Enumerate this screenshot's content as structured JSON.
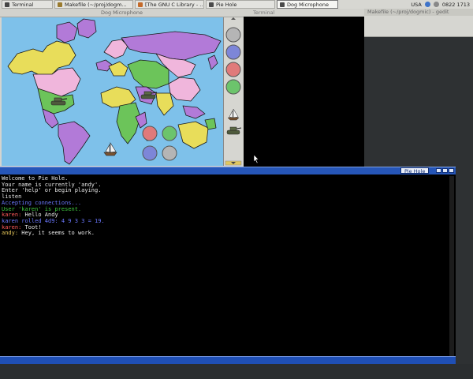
{
  "taskbar": {
    "tasks": [
      {
        "label": "Terminal",
        "color": "#454545"
      },
      {
        "label": "Makefile (~/proj/dogm...",
        "color": "#9a7b2f"
      },
      {
        "label": "[The GNU C Library - ...",
        "color": "#c46a2a"
      },
      {
        "label": "Pie Hole",
        "color": "#4a4a4a"
      },
      {
        "label": "Dog Microphone",
        "color": "#4a4a4a"
      }
    ],
    "tray": {
      "locale": "USA",
      "clock": "0822 1713"
    }
  },
  "windows": {
    "dog_microphone_title": "Dog Microphone",
    "terminal_title": "Terminal",
    "gedit_title": "Makefile (~/proj/dogmic) - gedit",
    "pie_hole_title": "Pie Hole"
  },
  "palette": {
    "swatches": [
      "#b5b5b5",
      "#7d86d8",
      "#e07a7a",
      "#6cc46c"
    ],
    "tools": [
      "boat-icon",
      "tank-icon"
    ]
  },
  "map": {
    "colors": {
      "ocean": "#7ec1ea",
      "purple": "#b27ad8",
      "yellow": "#e8dd5a",
      "pink": "#f0b6dc",
      "green": "#6cc45a"
    },
    "tokens": [
      {
        "kind": "red-circle"
      },
      {
        "kind": "green-circle"
      },
      {
        "kind": "blue-circle"
      },
      {
        "kind": "gray-circle"
      },
      {
        "kind": "tank"
      },
      {
        "kind": "tank"
      },
      {
        "kind": "boat"
      }
    ]
  },
  "console": {
    "lines": [
      {
        "text": "Welcome to Pie Hole.",
        "color": "#e8e8e8"
      },
      {
        "text": "Your name is currently 'andy'.",
        "color": "#e8e8e8"
      },
      {
        "text": "Enter 'help' or begin playing.",
        "color": "#e8e8e8"
      },
      {
        "text": "listen",
        "color": "#e8e8e8"
      },
      {
        "text": "Accepting connections...",
        "color": "#6b78ff"
      },
      {
        "text": "User 'karen' is present.",
        "color": "#3fc63f"
      },
      {
        "text": "karen: Hello Andy",
        "prefix": "karen: ",
        "prefix_color": "#ff5a5a",
        "rest": "Hello Andy",
        "color": "#e8e8e8"
      },
      {
        "text": "karen rolled 4d9: 4 9 3 3 = 19.",
        "color": "#6b78ff"
      },
      {
        "text": "karen: Toot!",
        "prefix": "karen: ",
        "prefix_color": "#ff5a5a",
        "rest": "Toot!",
        "color": "#e8e8e8"
      },
      {
        "text": "andy: Hey, it seems to work.",
        "prefix": "andy: ",
        "prefix_color": "#e8c85a",
        "rest": "Hey, it seems to work.",
        "color": "#e8e8e8"
      }
    ]
  }
}
